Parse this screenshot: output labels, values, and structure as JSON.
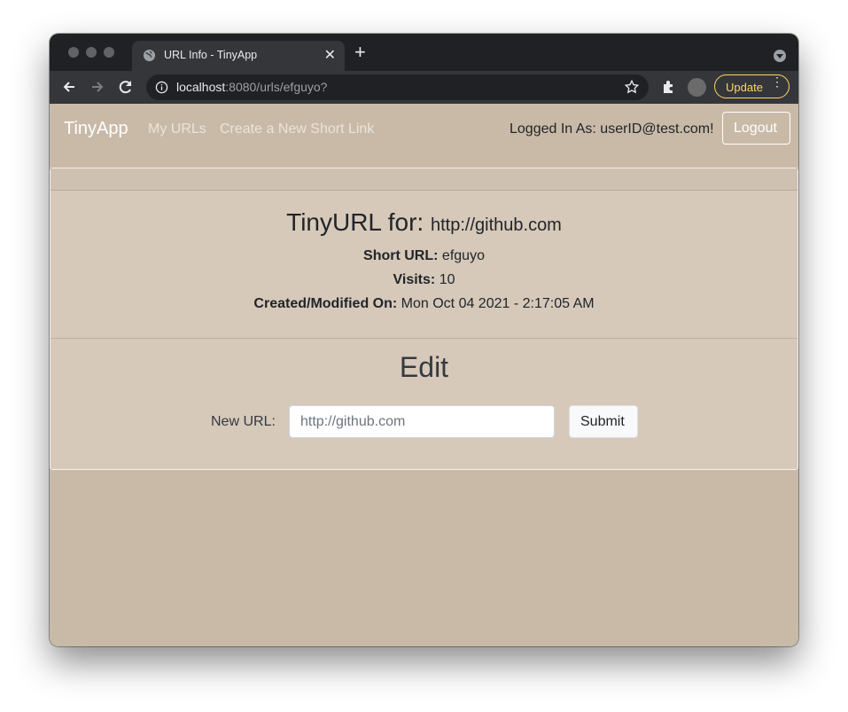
{
  "browser": {
    "tab_title": "URL Info - TinyApp",
    "tab_close": "✕",
    "new_tab": "+",
    "url_host": "localhost",
    "url_rest": ":8080/urls/efguyo?",
    "update_label": "Update",
    "update_menu": "⋮"
  },
  "navbar": {
    "brand": "TinyApp",
    "links": [
      "My URLs",
      "Create a New Short Link"
    ],
    "logged_in": "Logged In As: userID@test.com!",
    "logout": "Logout"
  },
  "card": {
    "heading_lead": "TinyURL for:",
    "heading_url": "http://github.com",
    "short_url_label": "Short URL:",
    "short_url_value": "efguyo",
    "visits_label": "Visits:",
    "visits_value": "10",
    "created_label": "Created/Modified On:",
    "created_value": "Mon Oct 04 2021 - 2:17:05 AM"
  },
  "edit": {
    "title": "Edit",
    "label": "New URL:",
    "placeholder": "http://github.com",
    "submit": "Submit"
  },
  "colors": {
    "page_bg": "#c9baa8",
    "card_bg": "#d6c9ba",
    "update_accent": "#fdd663"
  }
}
